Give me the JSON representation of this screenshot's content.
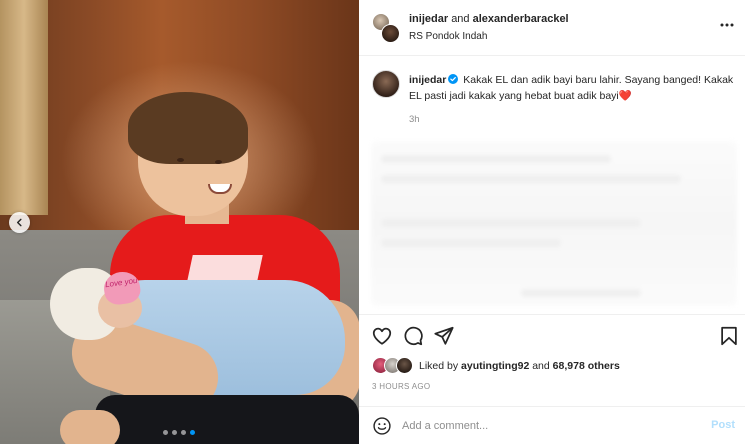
{
  "post": {
    "photo_badge_text": "Love you",
    "carousel": {
      "total": 4,
      "active_index": 3
    }
  },
  "header": {
    "user1": "inijedar",
    "joiner": "and",
    "user2": "alexanderbarackel",
    "location": "RS Pondok Indah"
  },
  "caption": {
    "username": "inijedar",
    "text": "Kakak EL dan adik bayi baru lahir. Sayang banged! Kakak EL pasti jadi kakak yang hebat buat adik bayi",
    "emoji": "❤️",
    "time": "3h"
  },
  "likes": {
    "prefix": "Liked by",
    "user": "ayutingting92",
    "joiner": "and",
    "others": "68,978 others"
  },
  "timestamp": "3 HOURS AGO",
  "comment": {
    "placeholder": "Add a comment...",
    "post_label": "Post"
  },
  "colors": {
    "accent": "#0095f6",
    "heart": "#ed4956",
    "post_disabled": "#b2dffc",
    "muted": "#8e8e8e"
  },
  "icons": [
    "more-icon",
    "verified-icon",
    "heart-icon",
    "comment-icon",
    "share-icon",
    "bookmark-icon",
    "emoji-icon",
    "chevron-left-icon"
  ]
}
